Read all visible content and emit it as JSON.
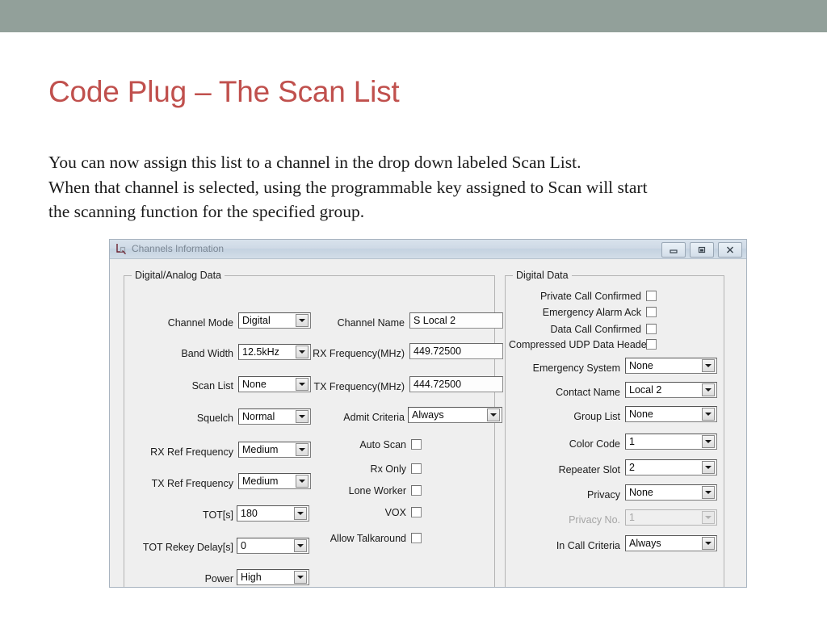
{
  "slide": {
    "title": "Code Plug – The Scan List",
    "body_lines": [
      "You can now assign this list to a channel in the drop down labeled Scan List.",
      "When that channel is selected, using the programmable key assigned to Scan will start",
      "the scanning function for the specified group."
    ],
    "banner_color": "#92a09a",
    "title_color": "#c0504d"
  },
  "dialog": {
    "title": "Channels Information",
    "window_buttons": [
      {
        "name": "minimize",
        "label": "–"
      },
      {
        "name": "restore",
        "label": "❐"
      },
      {
        "name": "close",
        "label": "✕"
      }
    ],
    "left_group": {
      "title": "Digital/Analog Data",
      "fields": [
        {
          "label": "Channel Mode",
          "value": "Digital",
          "type": "combo"
        },
        {
          "label": "Band Width",
          "value": "12.5kHz",
          "type": "combo"
        },
        {
          "label": "Scan List",
          "value": "None",
          "type": "combo"
        },
        {
          "label": "Squelch",
          "value": "Normal",
          "type": "combo"
        },
        {
          "label": "RX Ref Frequency",
          "value": "Medium",
          "type": "combo"
        },
        {
          "label": "TX Ref Frequency",
          "value": "Medium",
          "type": "combo"
        },
        {
          "label": "TOT[s]",
          "value": "180",
          "type": "combo"
        },
        {
          "label": "TOT Rekey Delay[s]",
          "value": "0",
          "type": "combo"
        },
        {
          "label": "Power",
          "value": "High",
          "type": "combo"
        }
      ],
      "mid_fields": [
        {
          "label": "Channel Name",
          "value": "S  Local 2",
          "type": "text"
        },
        {
          "label": "RX Frequency(MHz)",
          "value": "449.72500",
          "type": "text"
        },
        {
          "label": "TX Frequency(MHz)",
          "value": "444.72500",
          "type": "text"
        },
        {
          "label": "Admit Criteria",
          "value": "Always",
          "type": "combo"
        }
      ],
      "mid_checks": [
        {
          "label": "Auto Scan",
          "checked": false
        },
        {
          "label": "Rx Only",
          "checked": false
        },
        {
          "label": "Lone Worker",
          "checked": false
        },
        {
          "label": "VOX",
          "checked": false
        },
        {
          "label": "Allow Talkaround",
          "checked": false
        }
      ]
    },
    "right_group": {
      "title": "Digital Data",
      "checks": [
        {
          "label": "Private Call Confirmed",
          "checked": false
        },
        {
          "label": "Emergency Alarm Ack",
          "checked": false
        },
        {
          "label": "Data Call Confirmed",
          "checked": false
        },
        {
          "label": "Compressed UDP Data Header",
          "checked": false
        }
      ],
      "fields": [
        {
          "label": "Emergency System",
          "value": "None",
          "type": "combo",
          "disabled": false
        },
        {
          "label": "Contact Name",
          "value": "Local 2",
          "type": "combo",
          "disabled": false
        },
        {
          "label": "Group List",
          "value": "None",
          "type": "combo",
          "disabled": false
        },
        {
          "label": "Color Code",
          "value": "1",
          "type": "combo",
          "disabled": false
        },
        {
          "label": "Repeater Slot",
          "value": "2",
          "type": "combo",
          "disabled": false
        },
        {
          "label": "Privacy",
          "value": "None",
          "type": "combo",
          "disabled": false
        },
        {
          "label": "Privacy No.",
          "value": "1",
          "type": "combo",
          "disabled": true
        },
        {
          "label": "In Call Criteria",
          "value": "Always",
          "type": "combo",
          "disabled": false
        }
      ]
    }
  }
}
